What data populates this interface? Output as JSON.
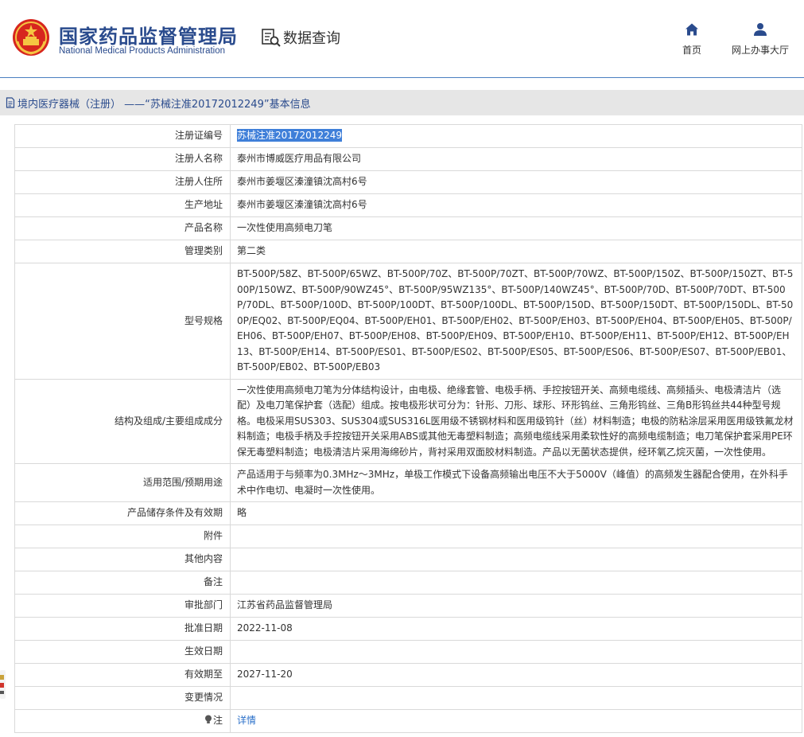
{
  "header": {
    "logo_cn": "国家药品监督管理局",
    "logo_en": "National Medical Products Administration",
    "section_title": "数据查询",
    "nav": [
      {
        "label": "首页",
        "icon": "home-icon"
      },
      {
        "label": "网上办事大厅",
        "icon": "user-icon"
      }
    ]
  },
  "breadcrumb": {
    "text": "境内医疗器械（注册） ——“苏械注准20172012249”基本信息"
  },
  "record": [
    {
      "label": "注册证编号",
      "value": "苏械注准20172012249"
    },
    {
      "label": "注册人名称",
      "value": "泰州市博威医疗用品有限公司"
    },
    {
      "label": "注册人住所",
      "value": "泰州市姜堰区溱潼镇沈高村6号"
    },
    {
      "label": "生产地址",
      "value": "泰州市姜堰区溱潼镇沈高村6号"
    },
    {
      "label": "产品名称",
      "value": "一次性使用高频电刀笔"
    },
    {
      "label": "管理类别",
      "value": "第二类"
    },
    {
      "label": "型号规格",
      "value": "BT-500P/58Z、BT-500P/65WZ、BT-500P/70Z、BT-500P/70ZT、BT-500P/70WZ、BT-500P/150Z、BT-500P/150ZT、BT-500P/150WZ、BT-500P/90WZ45°、BT-500P/95WZ135°、BT-500P/140WZ45°、BT-500P/70D、BT-500P/70DT、BT-500P/70DL、BT-500P/100D、BT-500P/100DT、BT-500P/100DL、BT-500P/150D、BT-500P/150DT、BT-500P/150DL、BT-500P/EQ02、BT-500P/EQ04、BT-500P/EH01、BT-500P/EH02、BT-500P/EH03、BT-500P/EH04、BT-500P/EH05、BT-500P/EH06、BT-500P/EH07、BT-500P/EH08、BT-500P/EH09、BT-500P/EH10、BT-500P/EH11、BT-500P/EH12、BT-500P/EH13、BT-500P/EH14、BT-500P/ES01、BT-500P/ES02、BT-500P/ES05、BT-500P/ES06、BT-500P/ES07、BT-500P/EB01、BT-500P/EB02、BT-500P/EB03"
    },
    {
      "label": "结构及组成/主要组成成分",
      "value": "一次性使用高频电刀笔为分体结构设计，由电极、绝缘套管、电极手柄、手控按钮开关、高频电缆线、高频插头、电极清洁片（选配）及电刀笔保护套（选配）组成。按电极形状可分为：针形、刀形、球形、环形钨丝、三角形钨丝、三角B形钨丝共44种型号规格。电极采用SUS303、SUS304或SUS316L医用级不锈钢材料和医用级钨针（丝）材料制造；电极的防粘涂层采用医用级铁氟龙材料制造；电极手柄及手控按钮开关采用ABS或其他无毒塑料制造；高频电缆线采用柔软性好的高频电缆制造；电刀笔保护套采用PE环保无毒塑料制造；电极清洁片采用海绵砂片，背衬采用双面胶材料制造。产品以无菌状态提供，经环氧乙烷灭菌，一次性使用。"
    },
    {
      "label": "适用范围/预期用途",
      "value": "产品适用于与频率为0.3MHz～3MHz，单极工作模式下设备高频输出电压不大于5000V（峰值）的高频发生器配合使用，在外科手术中作电切、电凝时一次性使用。"
    },
    {
      "label": "产品储存条件及有效期",
      "value": "略"
    },
    {
      "label": "附件",
      "value": ""
    },
    {
      "label": "其他内容",
      "value": ""
    },
    {
      "label": "备注",
      "value": ""
    },
    {
      "label": "审批部门",
      "value": "江苏省药品监督管理局"
    },
    {
      "label": "批准日期",
      "value": "2022-11-08"
    },
    {
      "label": "生效日期",
      "value": ""
    },
    {
      "label": "有效期至",
      "value": "2027-11-20"
    },
    {
      "label": "变更情况",
      "value": ""
    },
    {
      "label": "注",
      "value": "详情"
    }
  ]
}
